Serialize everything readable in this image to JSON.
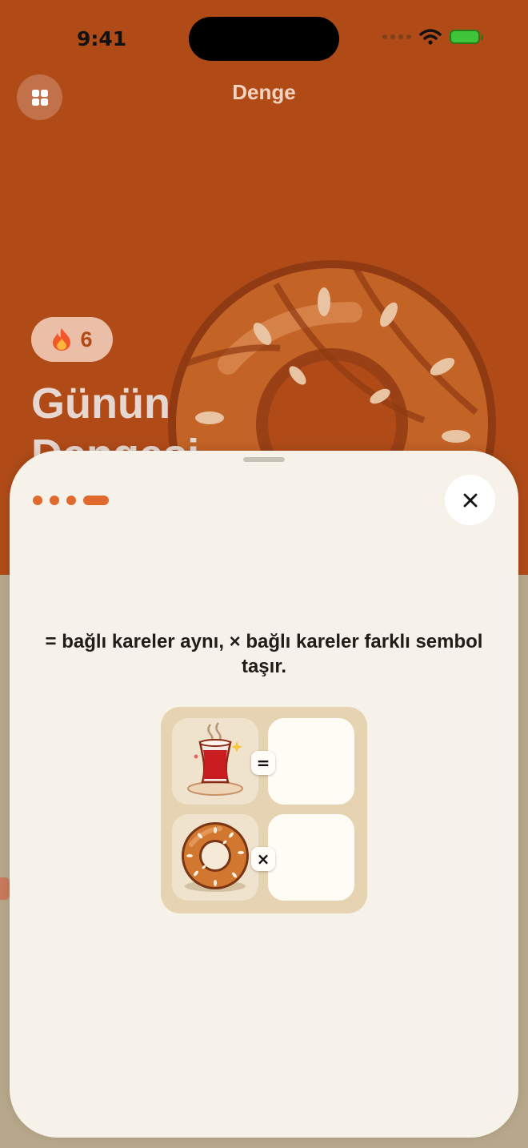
{
  "status_bar": {
    "time": "9:41"
  },
  "header": {
    "title": "Denge",
    "menu_icon": "grid-icon"
  },
  "hero": {
    "streak_icon": "flame-icon",
    "streak_count": "6",
    "heading": "Günün Dengesi"
  },
  "sheet": {
    "progress": {
      "total_steps": 4,
      "current_step": 4
    },
    "close_icon": "close-icon",
    "instruction": "= bağlı kareler aynı, × bağlı kareler farklı sembol taşır.",
    "example": {
      "rows": [
        {
          "symbol": "tea-glass-icon",
          "connector": "="
        },
        {
          "symbol": "simit-icon",
          "connector": "×"
        }
      ]
    }
  },
  "colors": {
    "accent": "#e06a2d",
    "hero_bg": "#b04b18",
    "sheet_bg": "#f7f2e9"
  }
}
